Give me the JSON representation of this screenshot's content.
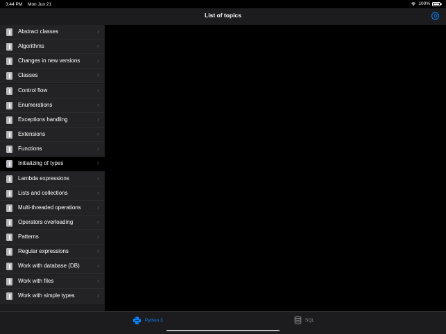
{
  "status_bar": {
    "time": "3:44 PM",
    "date": "Mon Jun 21",
    "battery": "100%"
  },
  "nav": {
    "title": "List of topics"
  },
  "topics": [
    {
      "label": "Abstract classes"
    },
    {
      "label": "Algorithms"
    },
    {
      "label": "Changes in new versions"
    },
    {
      "label": "Classes"
    },
    {
      "label": "Control flow"
    },
    {
      "label": "Enumerations"
    },
    {
      "label": "Exceptions handling"
    },
    {
      "label": "Extensions"
    },
    {
      "label": "Functions"
    },
    {
      "label": "Initializing of types",
      "selected": true
    },
    {
      "label": "Lambda expressions"
    },
    {
      "label": "Lists and collections"
    },
    {
      "label": "Multi-threaded operations"
    },
    {
      "label": "Operators overloading"
    },
    {
      "label": "Patterns"
    },
    {
      "label": "Regular expressions"
    },
    {
      "label": "Work with database (DB)"
    },
    {
      "label": "Work with files"
    },
    {
      "label": "Work with simple types"
    }
  ],
  "tabs": [
    {
      "label": "Python 3",
      "icon": "python-icon",
      "active": true
    },
    {
      "label": "SQL",
      "icon": "database-icon",
      "active": false
    }
  ],
  "colors": {
    "accent": "#0a84ff",
    "background": "#000000",
    "bar": "#1c1c1e"
  }
}
